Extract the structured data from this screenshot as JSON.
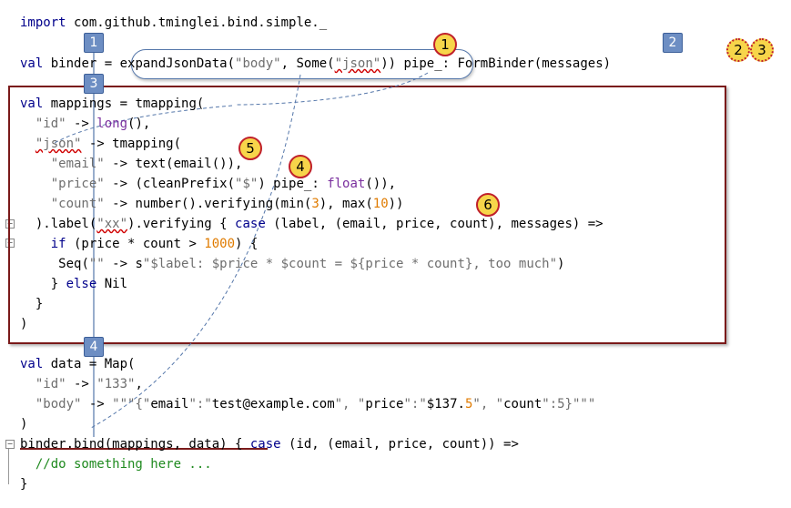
{
  "code": {
    "l1": {
      "kw": "import",
      "rest": " com.github.tminglei.bind.simple._"
    },
    "l2": {
      "kw": "val",
      "a": " binder = ",
      "b": "expandJsonData(",
      "s1": "\"body\"",
      "c": ", Some(",
      "s2": "\"json\"",
      "d": "))",
      "e": " pipe_: FormBinder(messages)"
    },
    "l3": {
      "kw": "val",
      "rest": " mappings = tmapping("
    },
    "l4": {
      "s": "\"id\"",
      "a": " -> ",
      "p": "long",
      "b": "(),"
    },
    "l5": {
      "s": "\"json\"",
      "a": " -> tmapping("
    },
    "l6": {
      "s": "\"email\"",
      "a": " -> text(email()),"
    },
    "l7": {
      "s": "\"price\"",
      "a": " -> (cleanPrefix(",
      "s2": "\"$\"",
      "b": ") pipe_: ",
      "p": "float",
      "c": "()),"
    },
    "l8": {
      "s": "\"count\"",
      "a": " -> number().verifying(min(",
      "n1": "3",
      "b": "), max(",
      "n2": "10",
      "c": "))"
    },
    "l9": {
      "a": ").label(",
      "s": "\"xx\"",
      "b": ").verifying { ",
      "kw": "case",
      "c": " (label, (email, price, count), messages) =>"
    },
    "l10": {
      "kw": "if",
      "a": " (price * count > ",
      "n": "1000",
      "b": ") {"
    },
    "l11": {
      "a": "Seq(",
      "s1": "\"\"",
      "b": " -> s",
      "s2": "\"$label: $price * $count = ${price * count}, too much\"",
      "c": ")"
    },
    "l12": {
      "a": "} ",
      "kw": "else",
      "b": " Nil"
    },
    "l13": {
      "a": "}"
    },
    "l14": {
      "a": ")"
    },
    "l15": {
      "kw": "val",
      "rest": " data = Map("
    },
    "l16": {
      "s1": "\"id\"",
      "a": " -> ",
      "s2": "\"133\"",
      "b": ","
    },
    "l17": {
      "s1": "\"body\"",
      "a": " -> ",
      "s2": "\"\"\"{\"",
      "t1": "email",
      "s3": "\":\"",
      "t2": "test@example.com",
      "s4": "\", \"",
      "t3": "price",
      "s5": "\":\"",
      "t4": "$137.",
      "n": "5",
      "s6": "\", \"",
      "t5": "count",
      "s7": "\":5}\"\"\""
    },
    "l18": {
      "a": ")"
    },
    "l19": {
      "a": "binder.bind(mappings, data)",
      "b": " { ",
      "kw": "case",
      "c": " (id, (email, price, count)) =>"
    },
    "l20": {
      "cmt": "//do something here ..."
    },
    "l21": {
      "a": "}"
    }
  },
  "markers": {
    "sq1": "1",
    "sq2": "2",
    "sq3": "3",
    "sq4": "4",
    "c1": "1",
    "c2": "2",
    "c3": "3",
    "c4": "4",
    "c5": "5",
    "c6": "6"
  },
  "colors": {
    "keyword": "#00008b",
    "string": "#6e6e6e",
    "number": "#e07b00",
    "comment": "#1f8a1f",
    "box": "#7a1a1a",
    "square": "#6d8ec3",
    "circle": "#f7d54a"
  }
}
